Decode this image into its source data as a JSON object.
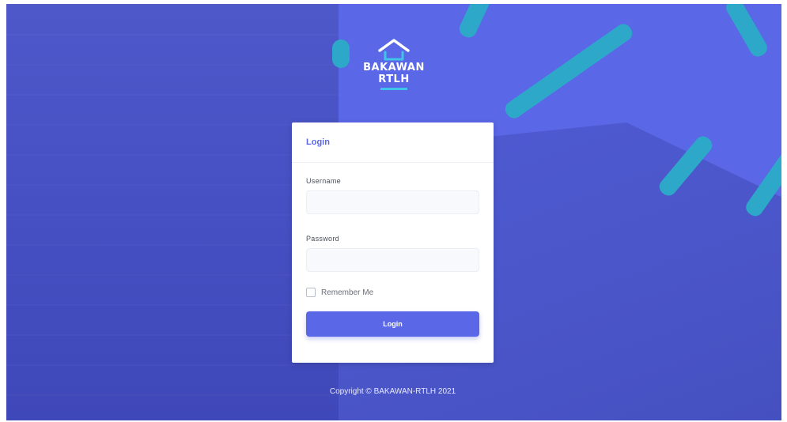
{
  "brand": {
    "name_line1": "BAKAWAN",
    "name_line2": "RTLH",
    "logo_icon": "house-outline-icon"
  },
  "login_card": {
    "title": "Login",
    "username_label": "Username",
    "username_value": "",
    "username_placeholder": "",
    "password_label": "Password",
    "password_value": "",
    "password_placeholder": "",
    "remember_label": "Remember Me",
    "remember_checked": false,
    "submit_label": "Login"
  },
  "footer": {
    "copyright": "Copyright © BAKAWAN-RTLH 2021"
  },
  "colors": {
    "accent": "#5a67e6",
    "background": "#4a56d6",
    "teal_decoration": "#2ea8c9",
    "logo_bar": "#3fc3e8"
  }
}
